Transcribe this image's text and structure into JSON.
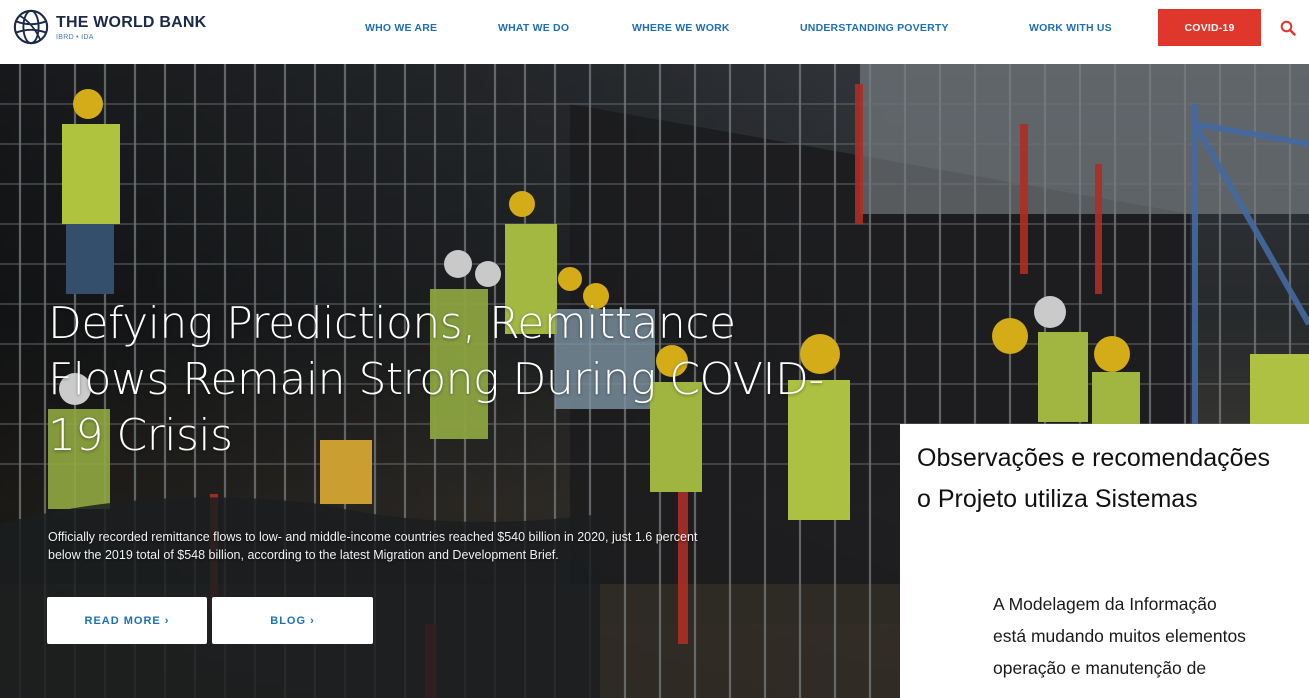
{
  "header": {
    "logo_name": "THE WORLD BANK",
    "logo_sub": "IBRD • IDA",
    "nav": [
      "WHO WE ARE",
      "WHAT WE DO",
      "WHERE WE WORK",
      "UNDERSTANDING POVERTY",
      "WORK WITH US"
    ],
    "covid_label": "COVID-19",
    "search_icon": "search-icon"
  },
  "hero": {
    "title_line1": "Defying Predictions, Remittance",
    "title_line2": "Flows Remain Strong During COVID-",
    "title_line3": "19 Crisis",
    "desc_line1": "Officially recorded remittance flows to low- and middle-income countries reached $540 billion in 2020, just 1.6 percent",
    "desc_line2": "below the 2019 total of $548 billion, according to the latest Migration and Development Brief.",
    "read_more_label": "READ MORE ›",
    "blog_label": "BLOG ›"
  },
  "overlay": {
    "title_line1": "Observações e recomendações",
    "title_line2": "o Projeto utiliza Sistemas",
    "body_line1": "A Modelagem da Informação",
    "body_line2": "está mudando muitos elementos",
    "body_line3": "operação e manutenção de"
  },
  "colors": {
    "accent_blue": "#1d6fb7",
    "covid_red": "#e0372c",
    "vest_yellow": "#c9e04a",
    "helmet_yellow": "#f2c41b"
  }
}
